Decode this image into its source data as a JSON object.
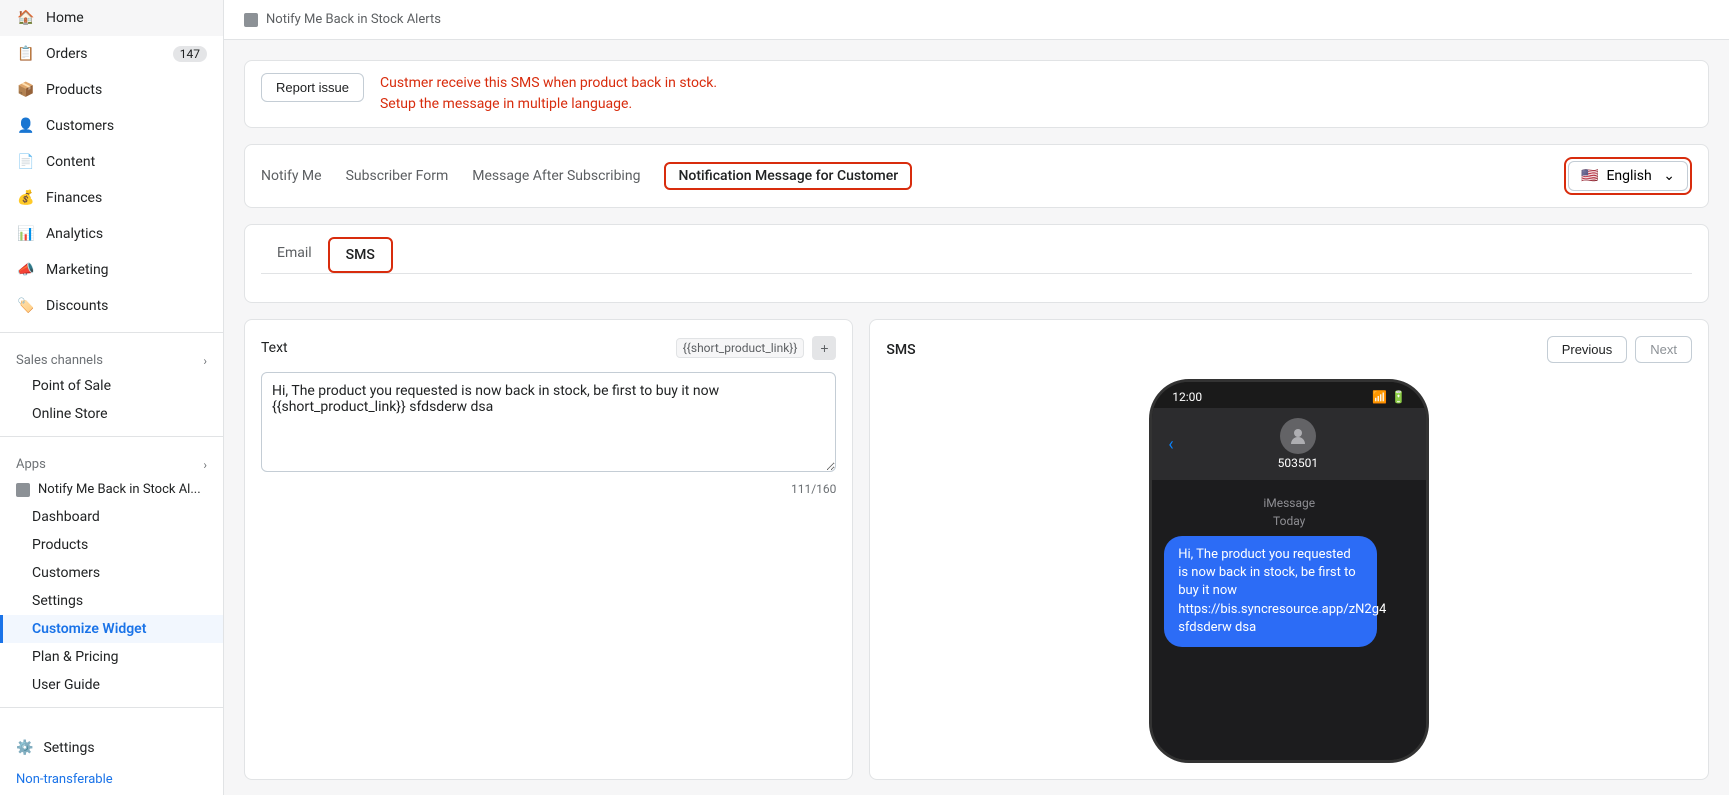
{
  "sidebar": {
    "nav_items": [
      {
        "id": "home",
        "label": "Home",
        "icon": "🏠",
        "badge": null
      },
      {
        "id": "orders",
        "label": "Orders",
        "icon": "📋",
        "badge": "147"
      },
      {
        "id": "products",
        "label": "Products",
        "icon": "📦",
        "badge": null
      },
      {
        "id": "customers",
        "label": "Customers",
        "icon": "👤",
        "badge": null
      },
      {
        "id": "content",
        "label": "Content",
        "icon": "📄",
        "badge": null
      },
      {
        "id": "finances",
        "label": "Finances",
        "icon": "💰",
        "badge": null
      },
      {
        "id": "analytics",
        "label": "Analytics",
        "icon": "📊",
        "badge": null
      },
      {
        "id": "marketing",
        "label": "Marketing",
        "icon": "📣",
        "badge": null
      },
      {
        "id": "discounts",
        "label": "Discounts",
        "icon": "🏷️",
        "badge": null
      }
    ],
    "sales_channels_title": "Sales channels",
    "sales_channels": [
      {
        "id": "pos",
        "label": "Point of Sale"
      },
      {
        "id": "online-store",
        "label": "Online Store"
      }
    ],
    "apps_title": "Apps",
    "app_name": "Notify Me Back in Stock Al...",
    "app_sub_items": [
      {
        "id": "dashboard",
        "label": "Dashboard",
        "active": false
      },
      {
        "id": "products",
        "label": "Products",
        "active": false
      },
      {
        "id": "customers",
        "label": "Customers",
        "active": false
      },
      {
        "id": "settings",
        "label": "Settings",
        "active": false
      },
      {
        "id": "customize-widget",
        "label": "Customize Widget",
        "active": true
      },
      {
        "id": "plan-pricing",
        "label": "Plan & Pricing",
        "active": false
      },
      {
        "id": "user-guide",
        "label": "User Guide",
        "active": false
      }
    ],
    "settings_label": "Settings",
    "non_transferable_label": "Non-transferable"
  },
  "breadcrumb": "Notify Me Back in Stock Alerts",
  "top_bar": {
    "report_btn": "Report issue",
    "warning_line1": "Custmer receive this SMS when product back in stock.",
    "warning_line2": "Setup the message in multiple language."
  },
  "tabs": {
    "items": [
      {
        "id": "notify-me",
        "label": "Notify Me"
      },
      {
        "id": "subscriber-form",
        "label": "Subscriber Form"
      },
      {
        "id": "message-after-subscribing",
        "label": "Message After Subscribing"
      },
      {
        "id": "notification-message",
        "label": "Notification Message for Customer",
        "active": true
      }
    ],
    "language": {
      "flag": "🇺🇸",
      "label": "English",
      "chevron": "⌄"
    }
  },
  "message_tabs": [
    {
      "id": "email",
      "label": "Email"
    },
    {
      "id": "sms",
      "label": "SMS",
      "active": true
    }
  ],
  "text_panel": {
    "label": "Text",
    "tag_value": "{{short_product_link}}",
    "tag_btn_label": "+",
    "content": "Hi, The product you requested is now back in stock, be first to buy it now {{short_product_link}} sfdsderw dsa",
    "char_count": "111/160"
  },
  "sms_panel": {
    "title": "SMS",
    "prev_btn": "Previous",
    "next_btn": "Next",
    "phone": {
      "time": "12:00",
      "contact_number": "503501",
      "imessage_label": "iMessage",
      "today_label": "Today",
      "message": "Hi, The product you requested is now back in stock, be first to buy it now https://bis.syncresource.app/zN2g4 sfdsderw dsa"
    }
  }
}
